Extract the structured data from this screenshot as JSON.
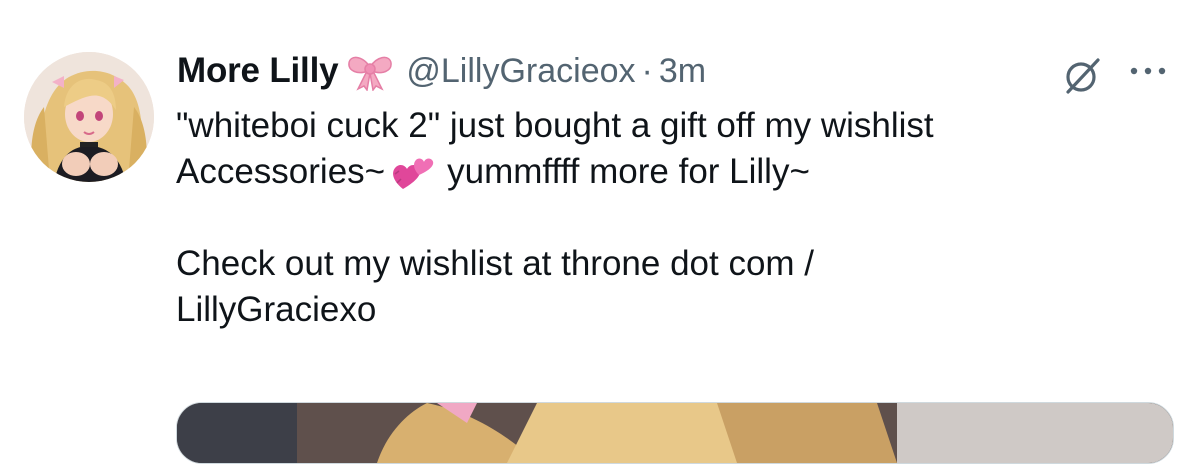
{
  "tweet": {
    "display_name": "More Lilly",
    "name_emoji": "ribbon",
    "handle": "@LillyGracieox",
    "separator": "·",
    "time": "3m",
    "lines": [
      "\"whiteboi cuck 2\" just bought a gift off my wishlist",
      "Accessories~",
      "yummffff more for Lilly~",
      "Check out my wishlist at throne dot com /",
      "LillyGraciexo"
    ],
    "inline_emoji": "two-hearts"
  },
  "icons": {
    "avatar": "avatar",
    "grok": "grok-icon",
    "more": "more-icon"
  },
  "colors": {
    "text_primary": "#0f1419",
    "text_secondary": "#536471",
    "ribbon": "#f4a9c2",
    "heart": "#e0479a"
  }
}
